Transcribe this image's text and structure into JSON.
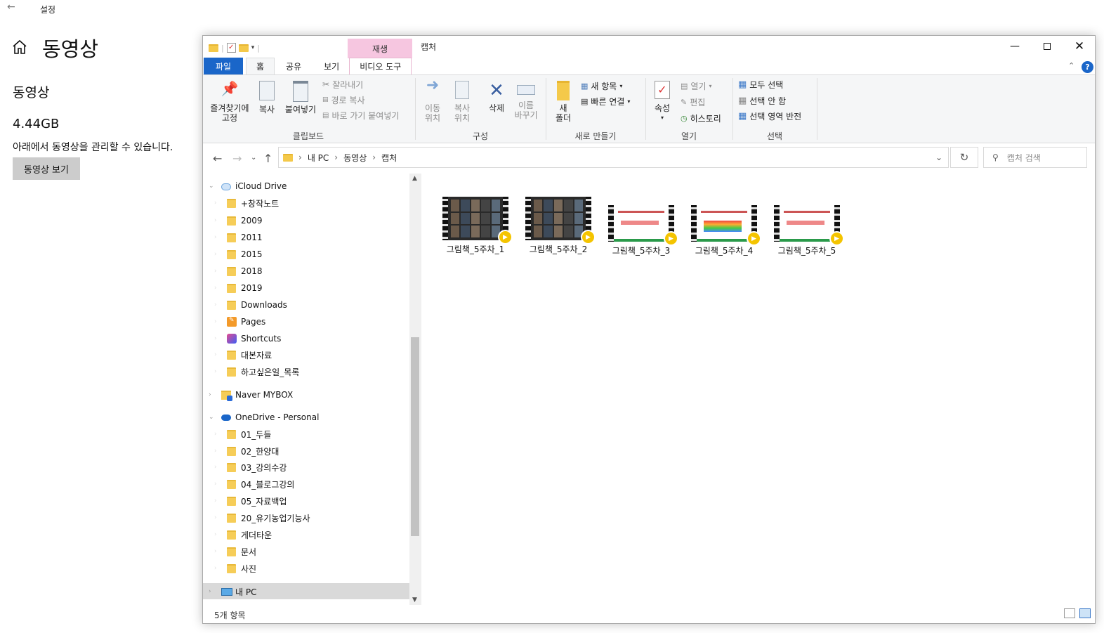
{
  "settings": {
    "back_icon": "back-arrow-icon",
    "window_title": "설정",
    "home_icon": "home-icon",
    "page_title": "동영상",
    "section_title": "동영상",
    "size": "4.44GB",
    "description": "아래에서 동영상을 관리할 수 있습니다.",
    "view_button": "동영상 보기"
  },
  "explorer": {
    "context_tab_header": "재생",
    "window_title": "캡처",
    "tabs": {
      "file": "파일",
      "home": "홈",
      "share": "공유",
      "view": "보기",
      "video_tools": "비디오 도구"
    },
    "ribbon": {
      "pin": "즐겨찾기에\n고정",
      "copy": "복사",
      "paste": "붙여넣기",
      "cut": "잘라내기",
      "copy_path": "경로 복사",
      "paste_shortcut": "바로 가기 붙여넣기",
      "clipboard_group": "클립보드",
      "move_to": "이동\n위치",
      "copy_to": "복사\n위치",
      "delete": "삭제",
      "rename": "이름\n바꾸기",
      "organize_group": "구성",
      "new_folder": "새\n폴더",
      "new_item": "새 항목",
      "easy_access": "빠른 연결",
      "new_group": "새로 만들기",
      "properties": "속성",
      "open": "열기",
      "edit": "편집",
      "history": "히스토리",
      "open_group": "열기",
      "select_all": "모두 선택",
      "select_none": "선택 안 함",
      "invert_selection": "선택 영역 반전",
      "select_group": "선택"
    },
    "address": {
      "segments": [
        "내 PC",
        "동영상",
        "캡처"
      ]
    },
    "search_placeholder": "캡처 검색",
    "tree": [
      {
        "label": "iCloud Drive",
        "icon": "icloud-icon"
      },
      {
        "label": "+창작노트",
        "icon": "folder-icon"
      },
      {
        "label": "2009",
        "icon": "folder-icon"
      },
      {
        "label": "2011",
        "icon": "folder-icon"
      },
      {
        "label": "2015",
        "icon": "folder-icon"
      },
      {
        "label": "2018",
        "icon": "folder-icon"
      },
      {
        "label": "2019",
        "icon": "folder-icon"
      },
      {
        "label": "Downloads",
        "icon": "folder-icon"
      },
      {
        "label": "Pages",
        "icon": "pages-icon"
      },
      {
        "label": "Shortcuts",
        "icon": "shortcuts-icon"
      },
      {
        "label": "대본자료",
        "icon": "folder-icon"
      },
      {
        "label": "하고싶은일_목록",
        "icon": "folder-icon"
      },
      {
        "label": "Naver MYBOX",
        "icon": "mybox-icon"
      },
      {
        "label": "OneDrive - Personal",
        "icon": "onedrive-icon"
      },
      {
        "label": "01_두들",
        "icon": "folder-icon"
      },
      {
        "label": "02_한양대",
        "icon": "folder-icon"
      },
      {
        "label": "03_강의수강",
        "icon": "folder-icon"
      },
      {
        "label": "04_블로그강의",
        "icon": "folder-icon"
      },
      {
        "label": "05_자료백업",
        "icon": "folder-icon"
      },
      {
        "label": "20_유기농업기능사",
        "icon": "folder-icon"
      },
      {
        "label": "게더타운",
        "icon": "folder-icon"
      },
      {
        "label": "문서",
        "icon": "folder-icon"
      },
      {
        "label": "사진",
        "icon": "folder-icon"
      },
      {
        "label": "내 PC",
        "icon": "pc-icon"
      }
    ],
    "files": [
      {
        "name": "그림책_5주차_1"
      },
      {
        "name": "그림책_5주차_2"
      },
      {
        "name": "그림책_5주차_3"
      },
      {
        "name": "그림책_5주차_4"
      },
      {
        "name": "그림책_5주차_5"
      }
    ],
    "status": "5개 항목",
    "colors": {
      "accent": "#1a66c9",
      "context_tab": "#f6c6e0",
      "play_badge": "#f4c400"
    }
  }
}
